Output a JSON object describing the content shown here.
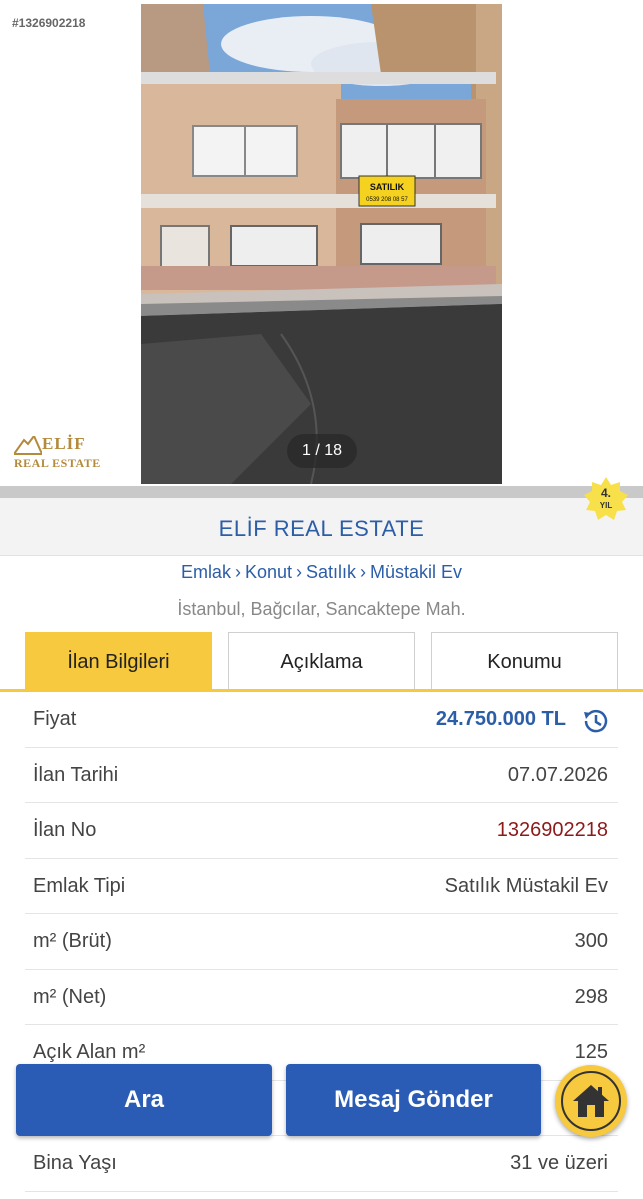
{
  "gallery": {
    "listing_tag": "#1326902218",
    "counter": "1 / 18",
    "sign_text": "SATILIK",
    "sign_phone": "0539 208 08 57",
    "logo_line1": "ELİF",
    "logo_line2": "REAL ESTATE"
  },
  "store": {
    "name": "ELİF REAL ESTATE",
    "badge_number": "4.",
    "badge_unit": "YIL",
    "badge_color": "#f7e04a"
  },
  "breadcrumb": [
    "Emlak",
    "Konut",
    "Satılık",
    "Müstakil Ev"
  ],
  "location": "İstanbul, Bağcılar, Sancaktepe Mah.",
  "tabs": [
    {
      "label": "İlan Bilgileri",
      "active": true
    },
    {
      "label": "Açıklama",
      "active": false
    },
    {
      "label": "Konumu",
      "active": false
    }
  ],
  "details": [
    {
      "key": "Fiyat",
      "value": "24.750.000 TL"
    },
    {
      "key": "İlan Tarihi",
      "value": "07.07.2026"
    },
    {
      "key": "İlan No",
      "value": "1326902218"
    },
    {
      "key": "Emlak Tipi",
      "value": "Satılık Müstakil Ev"
    },
    {
      "key": "m² (Brüt)",
      "value": "300"
    },
    {
      "key": "m² (Net)",
      "value": "298"
    },
    {
      "key": "Açık Alan m²",
      "value": "125"
    },
    {
      "key": "",
      "value": ""
    },
    {
      "key": "Bina Yaşı",
      "value": "31 ve üzeri"
    }
  ],
  "actions": {
    "search_label": "Ara",
    "message_label": "Mesaj Gönder"
  },
  "colors": {
    "accent_blue": "#2b5cb5",
    "accent_yellow": "#f7c93e",
    "listing_no_red": "#8b1a1a"
  },
  "icons": {
    "price_history": "history-icon",
    "home": "home-icon"
  }
}
